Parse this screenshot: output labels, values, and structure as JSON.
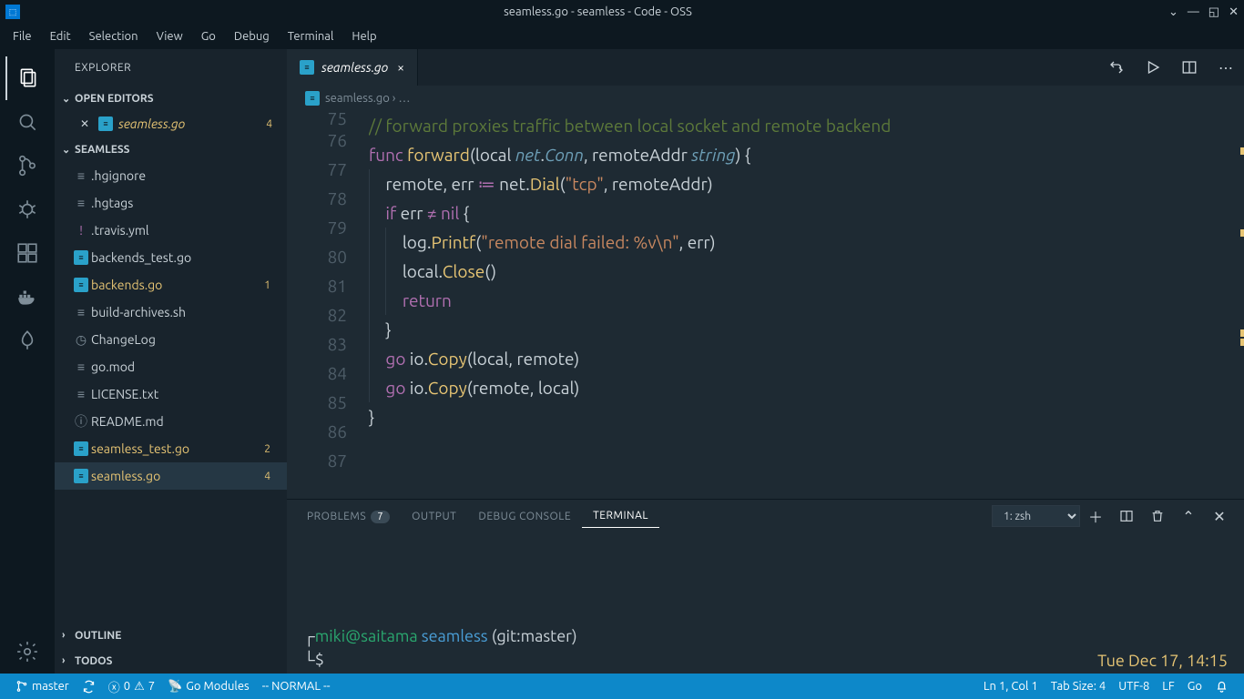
{
  "title": "seamless.go - seamless - Code - OSS",
  "menu": [
    "File",
    "Edit",
    "Selection",
    "View",
    "Go",
    "Debug",
    "Terminal",
    "Help"
  ],
  "sidebar_title": "EXPLORER",
  "open_editors": {
    "label": "OPEN EDITORS",
    "item": {
      "name": "seamless.go",
      "badge": "4"
    }
  },
  "project": "SEAMLESS",
  "files": [
    {
      "icon": "txt",
      "name": ".hgignore"
    },
    {
      "icon": "txt",
      "name": ".hgtags"
    },
    {
      "icon": "exc",
      "name": ".travis.yml",
      "icolor": "#b06fb0"
    },
    {
      "icon": "go",
      "name": "backends_test.go"
    },
    {
      "icon": "go",
      "name": "backends.go",
      "yellow": true,
      "badge": "1"
    },
    {
      "icon": "txt",
      "name": "build-archives.sh"
    },
    {
      "icon": "clk",
      "name": "ChangeLog"
    },
    {
      "icon": "txt",
      "name": "go.mod"
    },
    {
      "icon": "txt",
      "name": "LICENSE.txt"
    },
    {
      "icon": "inf",
      "name": "README.md"
    },
    {
      "icon": "go",
      "name": "seamless_test.go",
      "yellow": true,
      "badge": "2"
    },
    {
      "icon": "go",
      "name": "seamless.go",
      "yellow": true,
      "badge": "4",
      "sel": true
    }
  ],
  "outline": "OUTLINE",
  "todos": "TODOS",
  "tab": {
    "name": "seamless.go"
  },
  "breadcrumb": "seamless.go",
  "breadcrumb_more": "…",
  "lines": [
    75,
    76,
    77,
    78,
    79,
    80,
    81,
    82,
    83,
    84,
    85,
    86,
    87
  ],
  "panel": {
    "tabs": {
      "problems": "PROBLEMS",
      "problems_badge": "7",
      "output": "OUTPUT",
      "debug": "DEBUG CONSOLE",
      "terminal": "TERMINAL"
    },
    "select": "1: zsh",
    "prompt": {
      "user": "miki@saitama",
      "repo": "seamless",
      "branch": "(git:master)",
      "cursor": "$",
      "time": "Tue Dec 17, 14:15"
    }
  },
  "status": {
    "branch": "master",
    "errors": "0",
    "warnings": "7",
    "modules": "Go Modules",
    "mode": "-- NORMAL --",
    "pos": "Ln 1, Col 1",
    "tab": "Tab Size: 4",
    "enc": "UTF-8",
    "eol": "LF",
    "lang": "Go"
  }
}
